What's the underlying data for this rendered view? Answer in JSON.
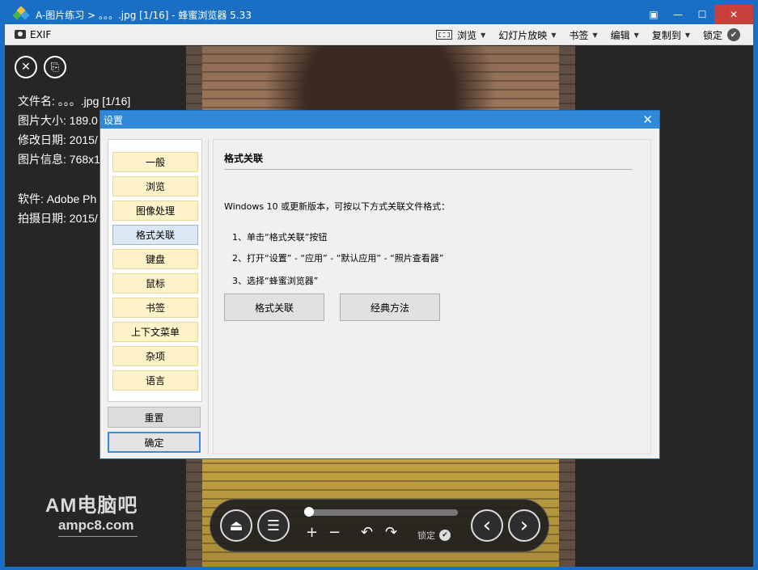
{
  "window": {
    "title": "A-图片练习 > 。。。.jpg [1/16] - 蜂蜜浏览器 5.33",
    "controls": {
      "restore": "▣",
      "minimize": "—",
      "maximize": "☐",
      "close": "✕"
    }
  },
  "toolbar": {
    "exif_label": "EXIF",
    "items": [
      {
        "label": "浏览"
      },
      {
        "label": "幻灯片放映"
      },
      {
        "label": "书签"
      },
      {
        "label": "编辑"
      },
      {
        "label": "复制到"
      },
      {
        "label": "锁定"
      }
    ],
    "caret": "▼",
    "lock_check": "✔"
  },
  "viewer": {
    "close_glyph": "✕",
    "copy_glyph": "⎘",
    "info": {
      "filename": "文件名: 。。。.jpg [1/16]",
      "size": "图片大小: 189.0",
      "modified": "修改日期: 2015/",
      "imginfo": "图片信息: 768x1",
      "software": "软件: Adobe Ph",
      "shot_date": "拍摄日期: 2015/"
    },
    "watermark": {
      "line1": "AM电脑吧",
      "line2": "ampc8.com"
    },
    "controls": {
      "eject": "⏏",
      "menu": "☰",
      "zoom_in": "+",
      "zoom_out": "−",
      "rotate_left": "↶",
      "rotate_right": "↷",
      "lock_label": "锁定",
      "lock_check": "✔",
      "prev": "‹",
      "next": "›"
    }
  },
  "dialog": {
    "title": "设置",
    "close_glyph": "✕",
    "nav": [
      "一般",
      "浏览",
      "图像处理",
      "格式关联",
      "键盘",
      "鼠标",
      "书签",
      "上下文菜单",
      "杂项",
      "语言"
    ],
    "active_nav": "格式关联",
    "reset_label": "重置",
    "ok_label": "确定",
    "section_title": "格式关联",
    "intro": "Windows 10 或更新版本，可按以下方式关联文件格式：",
    "steps": [
      "1、单击“格式关联”按钮",
      "2、打开“设置” - “应用” - “默认应用” - “照片查看器”",
      "3、选择“蜂蜜浏览器”"
    ],
    "buttons": {
      "associate": "格式关联",
      "classic": "经典方法"
    }
  }
}
